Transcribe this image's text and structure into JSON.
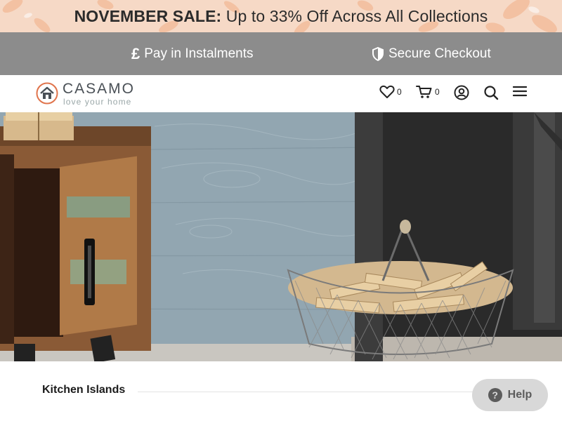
{
  "announcement": {
    "sale_label": "NOVEMBER SALE:",
    "sale_text": " Up to 33% Off Across All Collections"
  },
  "info_bar": {
    "pay_icon": "pound-icon",
    "pay_text": "Pay in Instalments",
    "secure_icon": "shield-icon",
    "secure_text": "Secure Checkout"
  },
  "header": {
    "logo_name": "CASAMO",
    "logo_tagline": "love your home",
    "wishlist_count": "0",
    "cart_count": "0",
    "icons": [
      "heart-icon",
      "cart-icon",
      "account-icon",
      "search-icon",
      "menu-icon"
    ]
  },
  "hero": {
    "image": "living-room-furniture-photo"
  },
  "section": {
    "title": "Kitchen Islands"
  },
  "help": {
    "label": "Help"
  },
  "colors": {
    "banner_bg": "#f6d9c6",
    "info_bar_bg": "#8c8c8c",
    "logo_accent": "#e0744c"
  }
}
